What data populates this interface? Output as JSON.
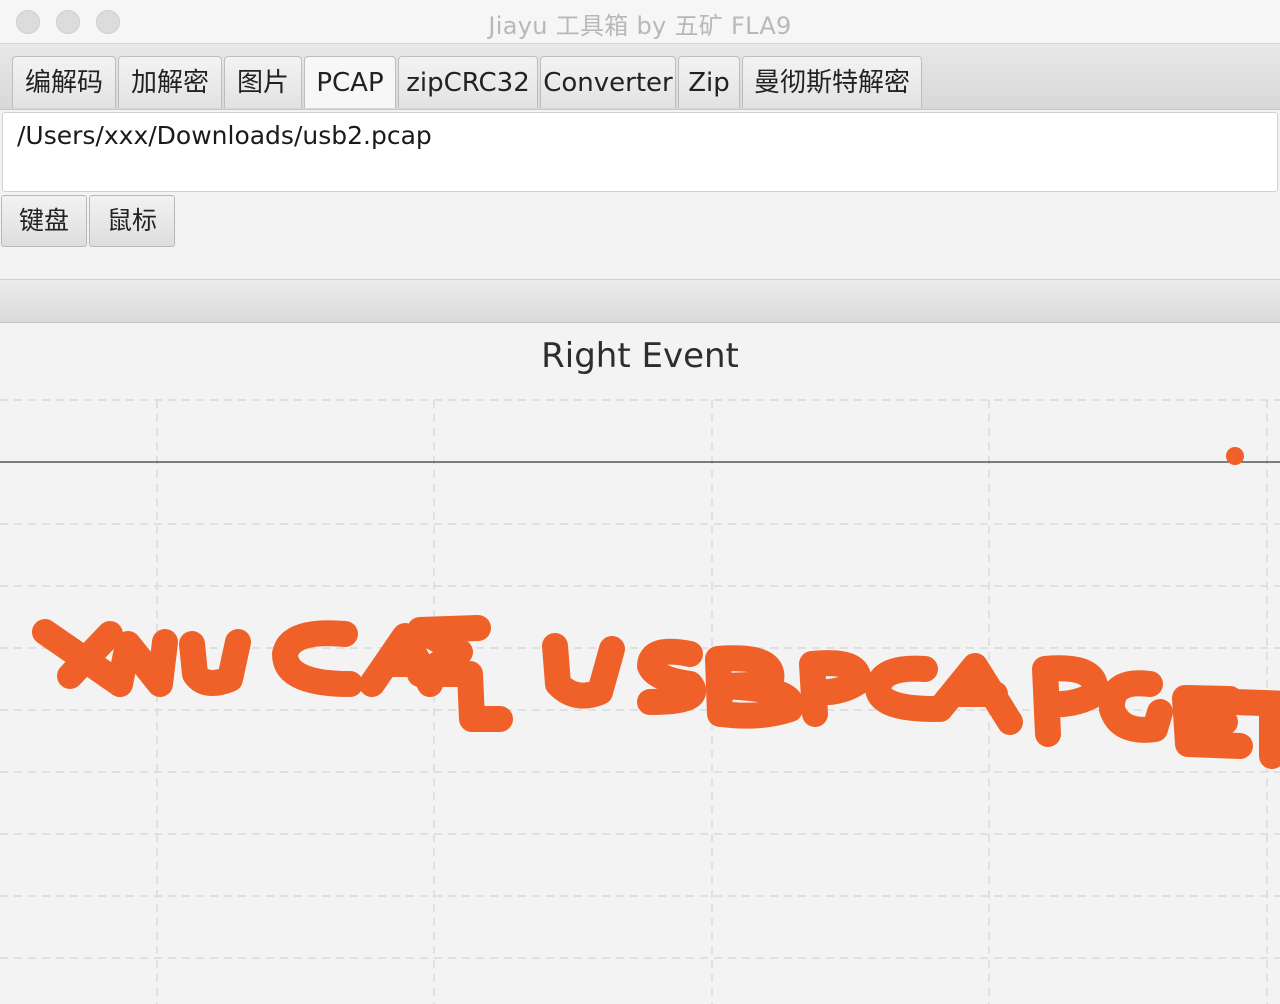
{
  "window": {
    "title": "Jiayu 工具箱 by 五矿 FLA9"
  },
  "tabs": [
    {
      "label": "编解码",
      "active": false
    },
    {
      "label": "加解密",
      "active": false
    },
    {
      "label": "图片",
      "active": false
    },
    {
      "label": "PCAP",
      "active": true
    },
    {
      "label": "zipCRC32",
      "active": false
    },
    {
      "label": "Converter",
      "active": false
    },
    {
      "label": "Zip",
      "active": false
    },
    {
      "label": "曼彻斯特解密",
      "active": false
    }
  ],
  "pcap": {
    "file_path": "/Users/xxx/Downloads/usb2.pcap",
    "keyboard_button": "键盘",
    "mouse_button": "鼠标"
  },
  "chart_data": {
    "type": "scatter",
    "title": "Right Event",
    "xlabel": "",
    "ylabel": "",
    "grid": true,
    "color": "#f0612a",
    "annotations": [
      "XNUCA{ USBPCAPGET"
    ],
    "points_note": "mouse right-click drag trace rendered as handwritten text"
  },
  "colors": {
    "trace": "#f0612a",
    "grid": "#d9d9d9",
    "axis": "#555555"
  }
}
